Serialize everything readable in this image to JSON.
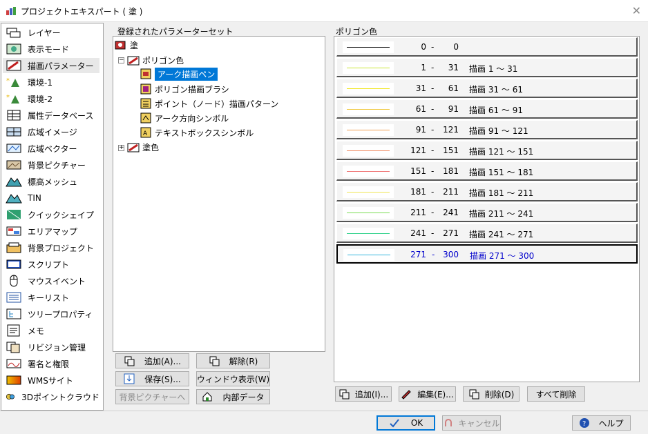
{
  "window": {
    "title": "プロジェクトエキスパート ( 塗 )"
  },
  "sidebar": {
    "items": [
      {
        "label": "レイヤー"
      },
      {
        "label": "表示モード"
      },
      {
        "label": "描画パラメーター"
      },
      {
        "label": "環境-1"
      },
      {
        "label": "環境-2"
      },
      {
        "label": "属性データベース"
      },
      {
        "label": "広域イメージ"
      },
      {
        "label": "広域ベクター"
      },
      {
        "label": "背景ピクチャー"
      },
      {
        "label": "標高メッシュ"
      },
      {
        "label": "TIN"
      },
      {
        "label": "クイックシェイプ"
      },
      {
        "label": "エリアマップ"
      },
      {
        "label": "背景プロジェクト"
      },
      {
        "label": "スクリプト"
      },
      {
        "label": "マウスイベント"
      },
      {
        "label": "キーリスト"
      },
      {
        "label": "ツリープロパティ"
      },
      {
        "label": "メモ"
      },
      {
        "label": "リビジョン管理"
      },
      {
        "label": "署名と権限"
      },
      {
        "label": "WMSサイト"
      },
      {
        "label": "3Dポイントクラウド"
      }
    ]
  },
  "params_panel": {
    "label": "登録されたパラメーターセット",
    "tree": {
      "root": "塗",
      "polygon": "ポリゴン色",
      "children": [
        "アーク描画ペン",
        "ポリゴン描画ブラシ",
        "ポイント（ノード）描画パターン",
        "アーク方向シンボル",
        "テキストボックスシンボル"
      ],
      "fill": "塗色"
    },
    "buttons": {
      "add": "追加(A)...",
      "release": "解除(R)",
      "save": "保存(S)...",
      "window": "ウィンドウ表示(W)",
      "bg": "背景ピクチャーへ",
      "internal": "内部データ"
    }
  },
  "color_panel": {
    "label": "ポリゴン色",
    "rows": [
      {
        "from": "0",
        "to": "0",
        "desc": "",
        "color": "#000000"
      },
      {
        "from": "1",
        "to": "31",
        "desc": "描画 1 ～ 31",
        "color": "#c8e632"
      },
      {
        "from": "31",
        "to": "61",
        "desc": "描画 31 ～ 61",
        "color": "#f0e61e"
      },
      {
        "from": "61",
        "to": "91",
        "desc": "描画 61 ～ 91",
        "color": "#f0c83c"
      },
      {
        "from": "91",
        "to": "121",
        "desc": "描画 91 ～ 121",
        "color": "#f0a050"
      },
      {
        "from": "121",
        "to": "151",
        "desc": "描画 121 ～ 151",
        "color": "#f08c64"
      },
      {
        "from": "151",
        "to": "181",
        "desc": "描画 151 ～ 181",
        "color": "#f07878"
      },
      {
        "from": "181",
        "to": "211",
        "desc": "描画 181 ～ 211",
        "color": "#f0e650"
      },
      {
        "from": "211",
        "to": "241",
        "desc": "描画 211 ～ 241",
        "color": "#78dc50"
      },
      {
        "from": "241",
        "to": "271",
        "desc": "描画 241 ～ 271",
        "color": "#32d28c"
      },
      {
        "from": "271",
        "to": "300",
        "desc": "描画 271 ～ 300",
        "color": "#32b4dc"
      }
    ],
    "buttons": {
      "add": "追加(I)...",
      "edit": "編集(E)...",
      "delete": "削除(D)",
      "delete_all": "すべて削除"
    }
  },
  "footer": {
    "ok": "OK",
    "cancel": "キャンセル",
    "help": "ヘルプ"
  }
}
